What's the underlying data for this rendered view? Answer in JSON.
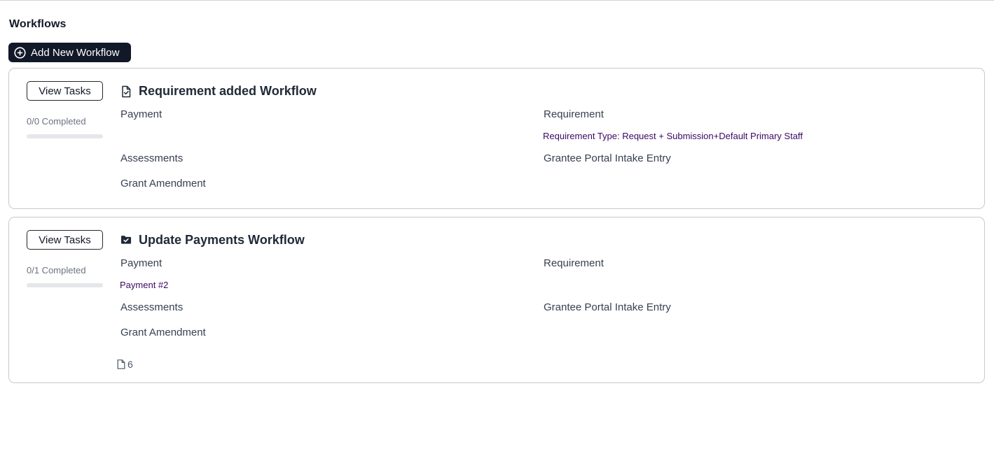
{
  "page": {
    "title": "Workflows",
    "add_button_label": "Add New Workflow"
  },
  "workflows": [
    {
      "title": "Requirement added Workflow",
      "icon": "document-check-icon",
      "view_tasks_label": "View Tasks",
      "completed_text": "0/0 Completed",
      "progress": 0,
      "fields": {
        "payment": {
          "label": "Payment",
          "value": ""
        },
        "requirement": {
          "label": "Requirement",
          "value": "Requirement Type: Request + Submission+Default Primary Staff"
        },
        "assessments": {
          "label": "Assessments",
          "value": ""
        },
        "grantee_portal": {
          "label": "Grantee Portal Intake Entry",
          "value": ""
        },
        "grant_amendment": {
          "label": "Grant Amendment",
          "value": ""
        }
      }
    },
    {
      "title": "Update Payments Workflow",
      "icon": "folder-check-icon",
      "view_tasks_label": "View Tasks",
      "completed_text": "0/1 Completed",
      "progress": 0,
      "fields": {
        "payment": {
          "label": "Payment",
          "value": "Payment #2"
        },
        "requirement": {
          "label": "Requirement",
          "value": ""
        },
        "assessments": {
          "label": "Assessments",
          "value": ""
        },
        "grantee_portal": {
          "label": "Grantee Portal Intake Entry",
          "value": ""
        },
        "grant_amendment": {
          "label": "Grant Amendment",
          "value": ""
        }
      },
      "attachments_count": "6"
    }
  ],
  "colors": {
    "primary_button": "#111827",
    "link_value": "#3b0764",
    "card_border": "#c9c9cf"
  }
}
